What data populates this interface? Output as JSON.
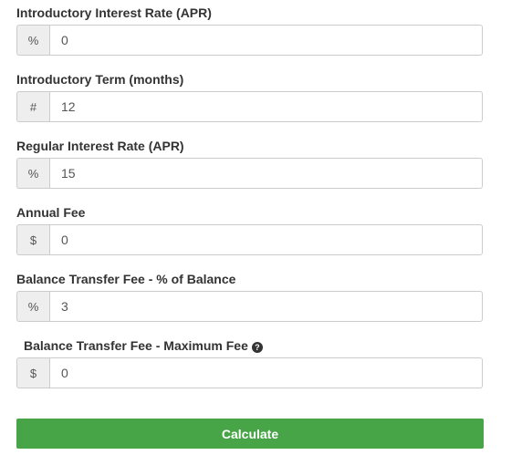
{
  "fields": [
    {
      "label": "Introductory Interest Rate (APR)",
      "addon": "%",
      "value": "0"
    },
    {
      "label": "Introductory Term (months)",
      "addon": "#",
      "value": "12"
    },
    {
      "label": "Regular Interest Rate (APR)",
      "addon": "%",
      "value": "15"
    },
    {
      "label": "Annual Fee",
      "addon": "$",
      "value": "0"
    },
    {
      "label": "Balance Transfer Fee - % of Balance",
      "addon": "%",
      "value": "3"
    },
    {
      "label": "Balance Transfer Fee - Maximum Fee",
      "addon": "$",
      "value": "0",
      "help_icon": "?"
    }
  ],
  "calculate_button": {
    "label": "Calculate"
  },
  "colors": {
    "button": "#47a447",
    "addon_bg": "#eeeeee",
    "border": "#cccccc"
  }
}
